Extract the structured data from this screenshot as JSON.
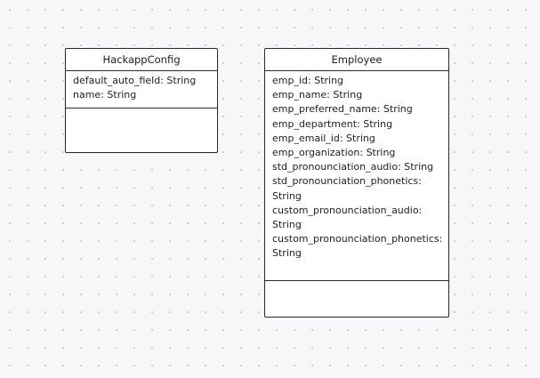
{
  "classes": [
    {
      "name": "HackappConfig",
      "attributes": [
        "default_auto_field: String",
        "name: String"
      ]
    },
    {
      "name": "Employee",
      "attributes": [
        "emp_id: String",
        "emp_name: String",
        "emp_preferred_name: String",
        "emp_department: String",
        "emp_email_id: String",
        "emp_organization: String",
        "std_pronounciation_audio: String",
        "std_pronounciation_phonetics:",
        "String",
        "custom_pronounciation_audio:",
        "String",
        "custom_pronounciation_phonetics:",
        "String"
      ]
    }
  ]
}
